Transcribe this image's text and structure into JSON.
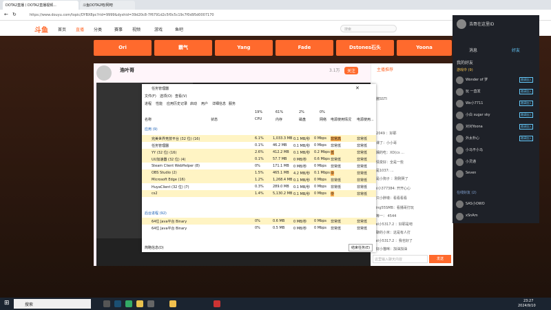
{
  "browser": {
    "tabs": [
      "DOTA2直播丨DOTA2直播视频...",
      "斗鱼DOTA2吧/网吧"
    ],
    "url": "https://www.douyu.com/topic/DYBX8pc?rid=9999&dyshid=39d20c8-7f6791d2c5f0c5c19c7f0d95d0007170"
  },
  "site": {
    "logo": "斗鱼",
    "nav": [
      "首页",
      "直播",
      "分类",
      "赛事",
      "视频",
      "游戏",
      "鱼吧"
    ],
    "search_placeholder": "搜索"
  },
  "categories": [
    "Ori",
    "霸气",
    "Yang",
    "Fade",
    "Dstones石头",
    "Yoona"
  ],
  "stream": {
    "streamer": "浩叶哥",
    "follow": "关注",
    "follow_count": "3.1万",
    "danmu_header": "主播推荐",
    "danmu_input_placeholder": "这里输入聊天内容",
    "send": "发送",
    "danmu": [
      "游酱SSTI",
      "Hi2049 ：好耶",
      "下课了：小小哥",
      "斑斓的吃：XD(cs ...",
      "心情变好：全是一些",
      "我是1037: ...",
      "你是小狗子 ：刚刚哭了",
      "hei小377384: 开开心心",
      "一只小胖墩：看看看看",
      "Wing55SMB：看播哥打玩",
      "三等一： 4544",
      "Mel小5317.2 ：好耶是吧",
      "无聊的小米：这是有人打",
      "Mel小5317.2 ：我也好了",
      "你好小猫咪：加油加油"
    ]
  },
  "taskmanager": {
    "title": "任务管理器",
    "menu": [
      "文件(F)",
      "选项(O)",
      "查看(V)"
    ],
    "tabs": [
      "进程",
      "性能",
      "应用历史记录",
      "启动",
      "用户",
      "详细信息",
      "服务"
    ],
    "headers": [
      "名称",
      "状态",
      "CPU",
      "内存",
      "磁盘",
      "网络",
      "电源使用情况",
      "电源使用..."
    ],
    "totals": [
      "19%",
      "61%",
      "2%",
      "0%"
    ],
    "section_apps": "应用 (9)",
    "section_bg": "后台进程 (92)",
    "rows": [
      {
        "name": "完美世界竞技平台 (32 位) (16)",
        "cpu": "6.1%",
        "mem": "1,033.3 MB",
        "disk": "0.1 MB/秒",
        "net": "0 Mbps",
        "power": "非常高",
        "trend": "非常低"
      },
      {
        "name": "任务管理器",
        "cpu": "0.1%",
        "mem": "46.2 MB",
        "disk": "0.1 MB/秒",
        "net": "0 Mbps",
        "power": "非常低",
        "trend": "非常低"
      },
      {
        "name": "YY (32 位) (16)",
        "cpu": "2.6%",
        "mem": "412.2 MB",
        "disk": "0.1 MB/秒",
        "net": "0.2 Mbps",
        "power": "低",
        "trend": "非常低"
      },
      {
        "name": "UU加速器 (32 位) (4)",
        "cpu": "0.1%",
        "mem": "57.7 MB",
        "disk": "0 MB/秒",
        "net": "0.6 Mbps",
        "power": "非常低",
        "trend": "非常低"
      },
      {
        "name": "Steam Client WebHelper (8)",
        "cpu": "0%",
        "mem": "171.1 MB",
        "disk": "0 MB/秒",
        "net": "0 Mbps",
        "power": "非常低",
        "trend": "非常低"
      },
      {
        "name": "OBS Studio (2)",
        "cpu": "1.5%",
        "mem": "465.1 MB",
        "disk": "4.2 MB/秒",
        "net": "0.1 Mbps",
        "power": "中",
        "trend": "非常低"
      },
      {
        "name": "Microsoft Edge (16)",
        "cpu": "1.2%",
        "mem": "1,268.4 MB",
        "disk": "0.1 MB/秒",
        "net": "0 Mbps",
        "power": "非常低",
        "trend": "非常低"
      },
      {
        "name": "HuyaClient (32 位) (7)",
        "cpu": "0.3%",
        "mem": "289.0 MB",
        "disk": "0.1 MB/秒",
        "net": "0 Mbps",
        "power": "非常低",
        "trend": "非常低"
      },
      {
        "name": "cs2",
        "cpu": "1.4%",
        "mem": "5,130.2 MB",
        "disk": "0.1 MB/秒",
        "net": "0 Mbps",
        "power": "中",
        "trend": "非常低"
      }
    ],
    "bg_rows": [
      {
        "name": "64位 Java平台 Binary",
        "cpu": "0%",
        "mem": "0.6 MB",
        "disk": "0 MB/秒",
        "net": "0 Mbps",
        "power": "非常低",
        "trend": "非常低"
      },
      {
        "name": "64位 Java平台 Binary",
        "cpu": "0%",
        "mem": "0.5 MB",
        "disk": "0 MB/秒",
        "net": "0 Mbps",
        "power": "非常低",
        "trend": "非常低"
      }
    ],
    "less": "简略信息(D)",
    "end_task": "结束任务(E)"
  },
  "panel": {
    "username": "浩哥在这里ID",
    "tabs": [
      "消息",
      "好友"
    ],
    "section": "我的好友",
    "group_game": "游戏中 (9)",
    "group_online": "在线好友 (2)",
    "friends": [
      "Wonder of 罗",
      "玩 一直发",
      "Wo小7711",
      "小白 sugar sky",
      "对对Yoona",
      "外太朴心",
      "小马不小马",
      "小灵通",
      "Seven",
      "SAS小OWO",
      "xSnAm"
    ],
    "badge": "邀请加入"
  },
  "taskbar": {
    "search": "搜索",
    "time": "23:27",
    "date": "2024/9/10"
  }
}
